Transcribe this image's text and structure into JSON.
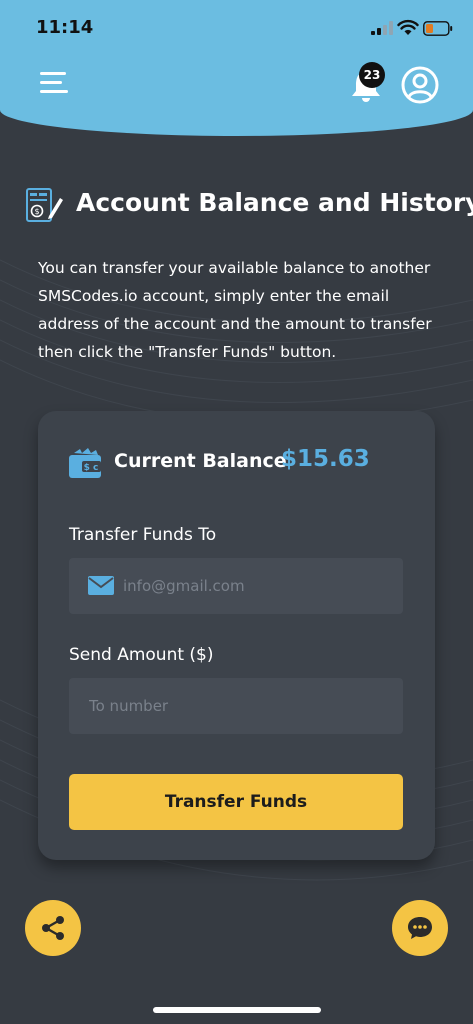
{
  "status_bar": {
    "time": "11:14"
  },
  "header": {
    "notification_count": "23"
  },
  "page": {
    "title": "Account Balance and History",
    "description": "You can transfer your available balance to another SMSCodes.io account, simply enter the email address of the account and the amount to transfer then click the \"Transfer Funds\" button."
  },
  "balance": {
    "label": "Current Balance",
    "value": "$15.63"
  },
  "transfer_form": {
    "to_label": "Transfer Funds To",
    "to_placeholder": "info@gmail.com",
    "amount_label": "Send Amount ($)",
    "amount_placeholder": "To number",
    "submit_label": "Transfer Funds"
  },
  "icons": {
    "menu": "hamburger-menu-icon",
    "notifications": "bell-icon",
    "profile": "user-circle-icon",
    "title": "invoice-pen-icon",
    "balance": "wallet-icon",
    "email": "envelope-icon",
    "share": "share-icon",
    "chat": "chat-bubble-icon"
  },
  "colors": {
    "header_bg": "#6bbde1",
    "page_bg": "#363b42",
    "card_bg": "#3d434b",
    "accent_yellow": "#f4c444",
    "balance_blue": "#5aafe0"
  }
}
